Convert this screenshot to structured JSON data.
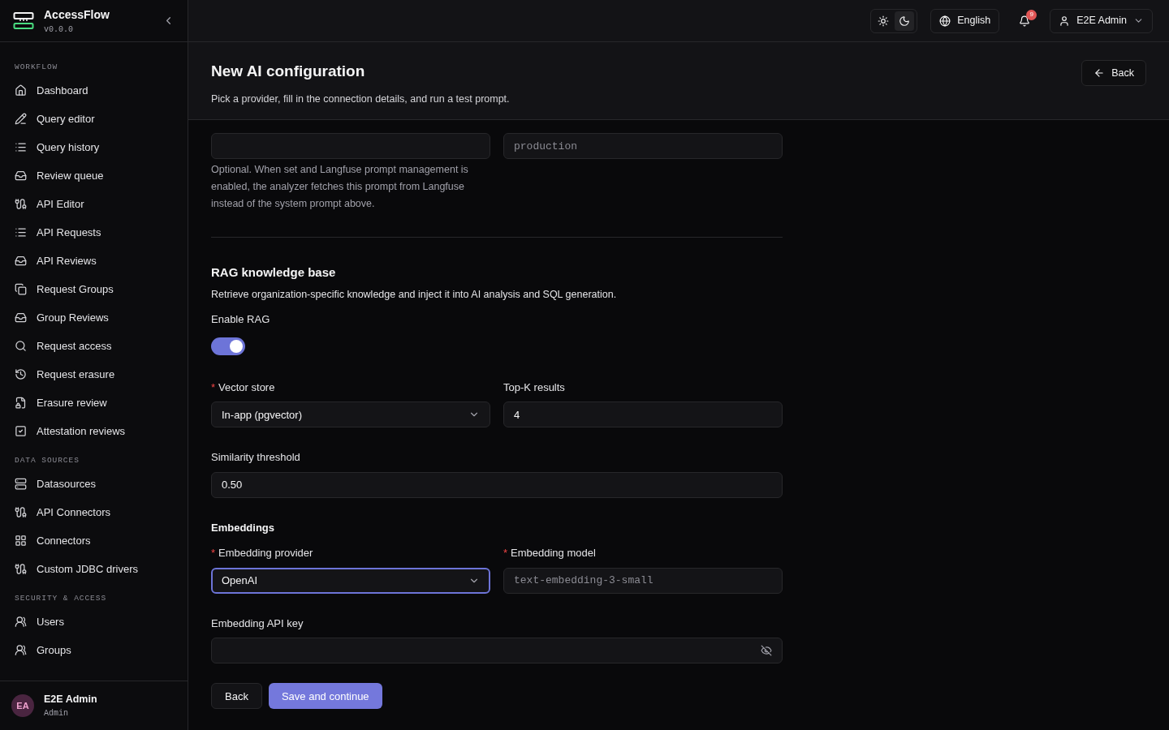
{
  "app": {
    "name": "AccessFlow",
    "version": "v0.0.0"
  },
  "sidebar": {
    "sections": [
      {
        "title": "WORKFLOW",
        "items": [
          {
            "label": "Dashboard"
          },
          {
            "label": "Query editor"
          },
          {
            "label": "Query history"
          },
          {
            "label": "Review queue"
          },
          {
            "label": "API Editor"
          },
          {
            "label": "API Requests"
          },
          {
            "label": "API Reviews"
          },
          {
            "label": "Request Groups"
          },
          {
            "label": "Group Reviews"
          },
          {
            "label": "Request access"
          },
          {
            "label": "Request erasure"
          },
          {
            "label": "Erasure review"
          },
          {
            "label": "Attestation reviews"
          }
        ]
      },
      {
        "title": "DATA SOURCES",
        "items": [
          {
            "label": "Datasources"
          },
          {
            "label": "API Connectors"
          },
          {
            "label": "Connectors"
          },
          {
            "label": "Custom JDBC drivers"
          }
        ]
      },
      {
        "title": "SECURITY & ACCESS",
        "items": [
          {
            "label": "Users"
          },
          {
            "label": "Groups"
          }
        ]
      }
    ],
    "user": {
      "initials": "EA",
      "name": "E2E Admin",
      "role": "Admin"
    }
  },
  "topbar": {
    "theme_options": [
      {
        "selected": false
      },
      {
        "selected": true
      }
    ],
    "language": "English",
    "notifications": "9",
    "user": "E2E Admin"
  },
  "page": {
    "title": "New AI configuration",
    "subtitle": "Pick a provider, fill in the connection details, and run a test prompt.",
    "back": "Back"
  },
  "langfuse": {
    "label_field": {
      "placeholder": "production"
    },
    "help": "Optional. When set and Langfuse prompt management is enabled, the analyzer fetches this prompt from Langfuse instead of the system prompt above."
  },
  "rag": {
    "title": "RAG knowledge base",
    "description": "Retrieve organization-specific knowledge and inject it into AI analysis and SQL generation.",
    "enable_label": "Enable RAG",
    "enabled": true,
    "vector_store": {
      "label": "Vector store",
      "required_mark": "*",
      "value": "In-app (pgvector)"
    },
    "top_k": {
      "label": "Top-K results",
      "value": "4"
    },
    "similarity": {
      "label": "Similarity threshold",
      "value": "0.50"
    }
  },
  "embeddings": {
    "title": "Embeddings",
    "provider": {
      "label": "Embedding provider",
      "required_mark": "*",
      "value": "OpenAI",
      "focused": true
    },
    "model": {
      "label": "Embedding model",
      "required_mark": "*",
      "placeholder": "text-embedding-3-small"
    },
    "api_key": {
      "label": "Embedding API key"
    }
  },
  "actions": {
    "back": "Back",
    "save": "Save and continue"
  }
}
